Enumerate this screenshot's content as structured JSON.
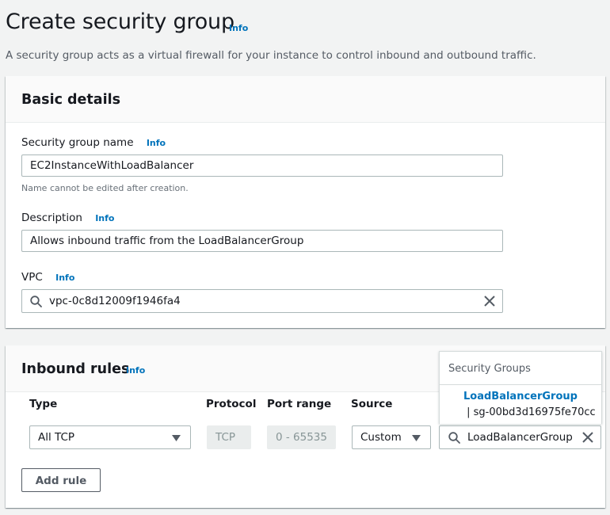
{
  "page": {
    "title": "Create security group",
    "info": "Info",
    "description": "A security group acts as a virtual firewall for your instance to control inbound and outbound traffic."
  },
  "basic_details": {
    "title": "Basic details",
    "name_label": "Security group name",
    "name_info": "Info",
    "name_value": "EC2InstanceWithLoadBalancer",
    "name_hint": "Name cannot be edited after creation.",
    "description_label": "Description",
    "description_info": "Info",
    "description_value": "Allows inbound traffic from the LoadBalancerGroup",
    "vpc_label": "VPC",
    "vpc_info": "Info",
    "vpc_value": "vpc-0c8d12009f1946fa4"
  },
  "inbound_rules": {
    "title": "Inbound rules",
    "info": "Info",
    "columns": {
      "type": "Type",
      "protocol": "Protocol",
      "port_range": "Port range",
      "source": "Source"
    },
    "rules": [
      {
        "type": "All TCP",
        "protocol": "TCP",
        "port_range": "0 - 65535",
        "source": "Custom",
        "source_search_value": "LoadBalancerGroup"
      }
    ],
    "add_rule_label": "Add rule"
  },
  "source_dropdown": {
    "group_label": "Security Groups",
    "options": [
      {
        "name": "LoadBalancerGroup",
        "separator": " | ",
        "id": "sg-00bd3d16975fe70cc"
      }
    ]
  },
  "colors": {
    "link": "#0073bb",
    "background": "#f2f3f3",
    "panel_header": "#fafafa",
    "text": "#16191f",
    "disabled": "#eaeded"
  }
}
